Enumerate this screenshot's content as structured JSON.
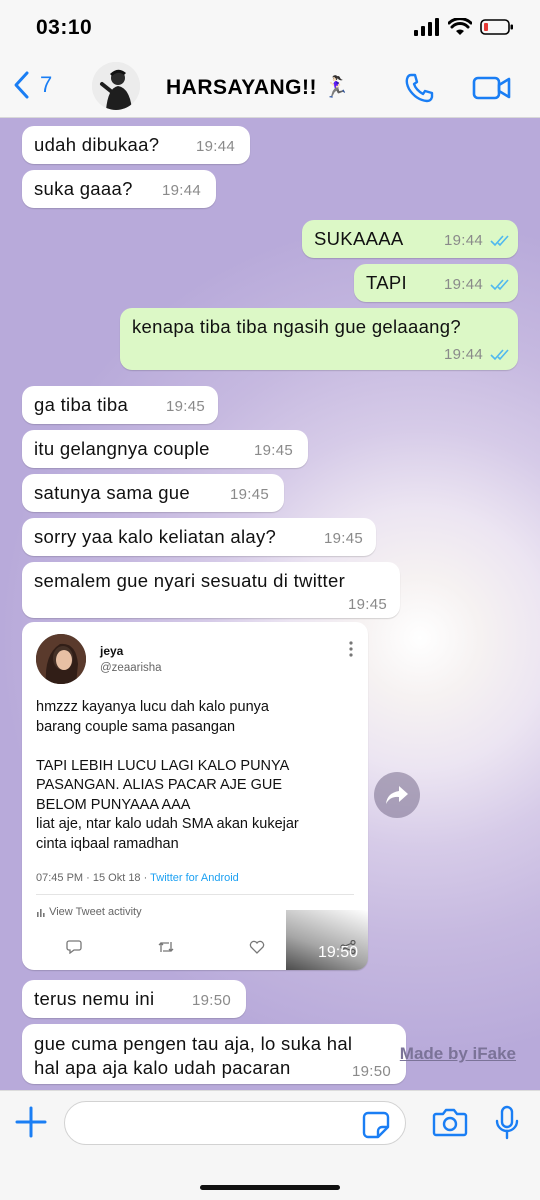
{
  "status_bar": {
    "time": "03:10"
  },
  "header": {
    "back_count": "7",
    "contact_name": "HARSAYANG!! 🏃🏻‍♀️"
  },
  "messages": [
    {
      "text": "udah dibukaa?",
      "time": "19:44"
    },
    {
      "text": "suka gaaa?",
      "time": "19:44"
    },
    {
      "text": "SUKAAAA",
      "time": "19:44"
    },
    {
      "text": "TAPI",
      "time": "19:44"
    },
    {
      "text": "kenapa tiba tiba ngasih gue gelaaang?",
      "time": "19:44"
    },
    {
      "text": "ga tiba tiba",
      "time": "19:45"
    },
    {
      "text": "itu gelangnya couple",
      "time": "19:45"
    },
    {
      "text": "satunya sama gue",
      "time": "19:45"
    },
    {
      "text": "sorry yaa kalo keliatan alay?",
      "time": "19:45"
    },
    {
      "text": "semalem gue nyari sesuatu di twitter",
      "time": "19:45"
    },
    {
      "text": "terus nemu ini",
      "time": "19:50"
    },
    {
      "text_line1": "gue cuma pengen tau aja, lo suka hal",
      "text_line2": "hal apa aja kalo udah pacaran",
      "time": "19:50"
    }
  ],
  "tweet": {
    "name": "jeya",
    "handle": "@zeaarisha",
    "text": "hmzzz kayanya lucu dah kalo punya\nbarang couple sama pasangan\n\nTAPI LEBIH LUCU LAGI KALO PUNYA\nPASANGAN. ALIAS PACAR AJE GUE\nBELOM PUNYAAA AAA\nliat aje, ntar kalo udah SMA akan kukejar\ncinta iqbaal ramadhan",
    "date": "07:45 PM · 15 Okt 18 · ",
    "source": "Twitter for Android",
    "activity": "View Tweet activity",
    "time": "19:50"
  },
  "watermark": "Made by iFake",
  "input": {
    "placeholder": ""
  },
  "colors": {
    "accent": "#1a7ef4",
    "outgoing_bubble": "#dcf8c6",
    "incoming_bubble": "#ffffff",
    "read_ticks": "#4fb8ef"
  }
}
